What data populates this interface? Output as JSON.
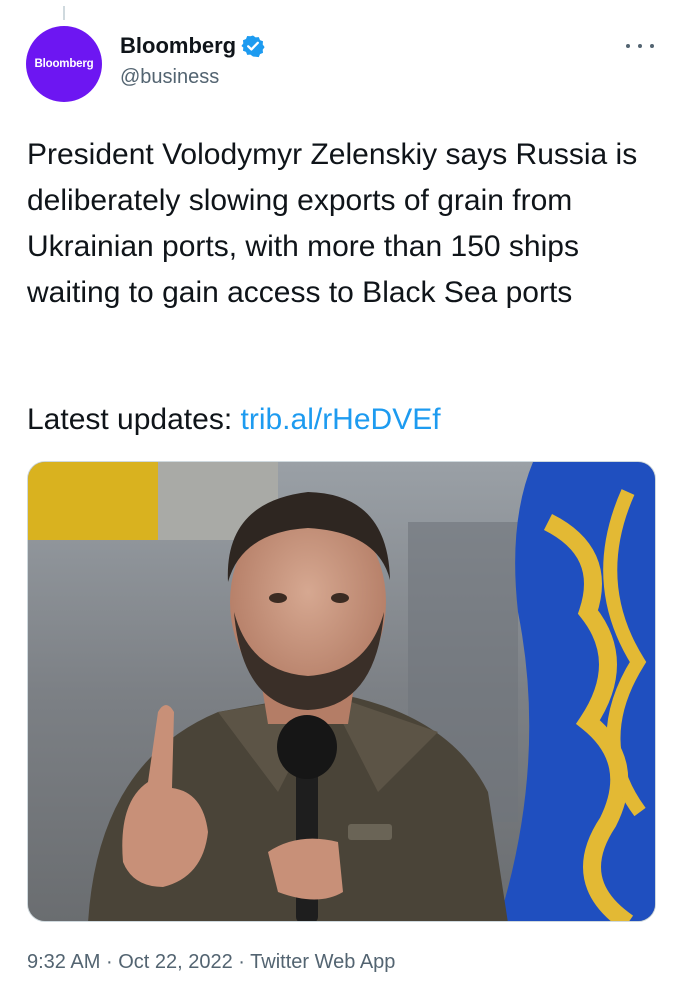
{
  "author": {
    "display_name": "Bloomberg",
    "handle": "@business",
    "avatar_text": "Bloomberg",
    "verified": true,
    "colors": {
      "avatar_bg": "#6d16f2",
      "verified": "#1d9bf0"
    }
  },
  "tweet": {
    "text": "President Volodymyr Zelenskiy says Russia is deliberately slowing exports of grain from Ukrainian ports, with more than 150 ships waiting to gain access to Black Sea ports",
    "updates_label": "Latest updates:",
    "link_text": "trib.al/rHeDVEf",
    "media_icon": "photo-icon"
  },
  "meta": {
    "time": "9:32 AM",
    "separator": "·",
    "date": "Oct 22, 2022",
    "source": "Twitter Web App"
  },
  "icons": {
    "more": "more-horizontal-icon",
    "verified": "verified-badge-icon"
  }
}
